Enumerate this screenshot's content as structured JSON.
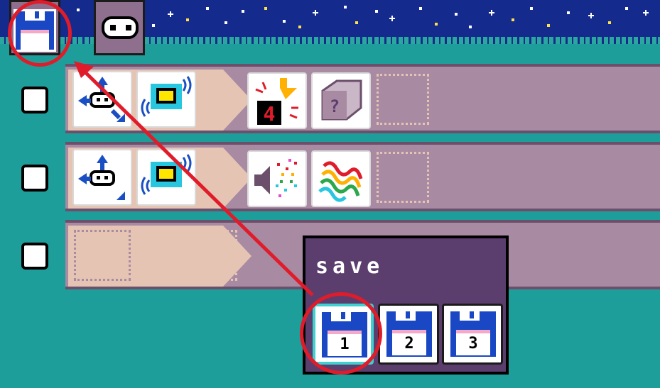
{
  "app": {
    "accent_sky": "#142a8c",
    "accent_bg": "#1e9e9a",
    "highlight_color": "#e11c2a"
  },
  "topbar": {
    "items": [
      {
        "icon": "floppy-disk-icon"
      },
      {
        "icon": "robot-face-icon"
      }
    ]
  },
  "rules": [
    {
      "when": [
        "robot-move-icon",
        "sensor-screen-icon"
      ],
      "do": [
        "explosion-counter-icon",
        "random-dice-icon"
      ],
      "counter": "4"
    },
    {
      "when": [
        "robot-move-icon",
        "sensor-screen-icon"
      ],
      "do": [
        "speaker-sound-icon",
        "rainbow-wave-icon"
      ]
    },
    {
      "when": [],
      "do": []
    }
  ],
  "save_dialog": {
    "title": "save",
    "slots": [
      {
        "label": "1",
        "selected": true
      },
      {
        "label": "2",
        "selected": false
      },
      {
        "label": "3",
        "selected": false
      }
    ]
  }
}
